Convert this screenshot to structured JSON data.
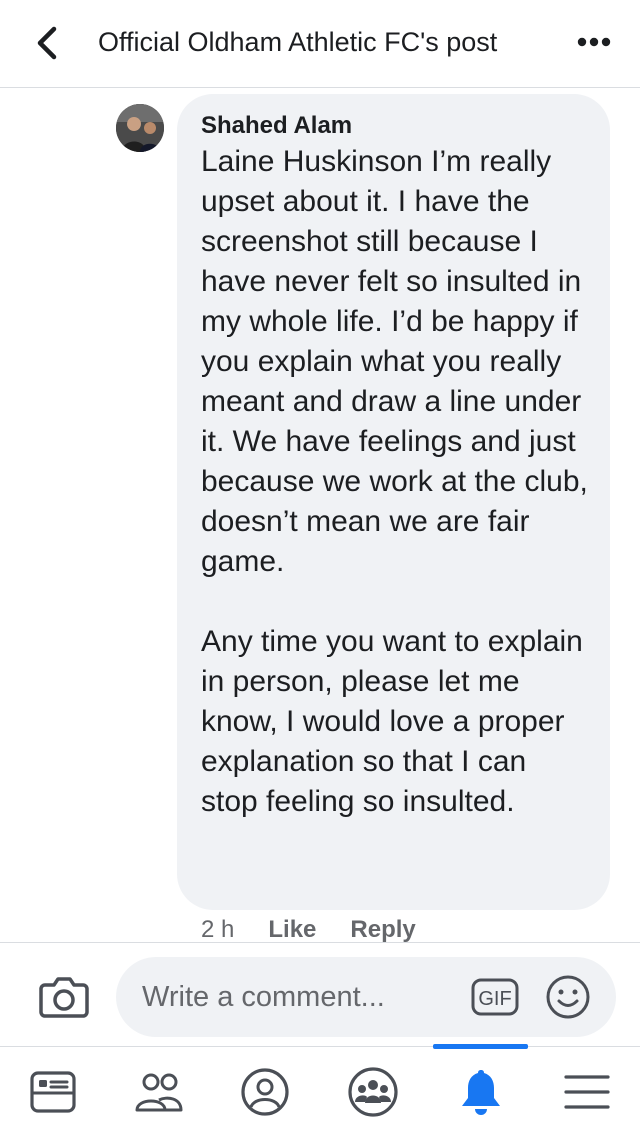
{
  "header": {
    "title": "Official Oldham Athletic FC's post",
    "back_icon": "chevron-left-icon",
    "more_icon": "more-dots-icon"
  },
  "comment": {
    "author": "Shahed Alam",
    "text": "Laine Huskinson I’m really upset about it. I have the screenshot still because I have never felt so insulted in my whole life. I’d be happy if you explain what you really meant and draw a line under it. We have feelings and just because we work at the club, doesn’t mean we are fair game.\n\nAny time you want to explain in person, please let me know, I would love a proper explanation so that I can stop feeling so insulted.",
    "time": "2 h",
    "like_label": "Like",
    "reply_label": "Reply"
  },
  "composer": {
    "placeholder": "Write a comment...",
    "gif_label": "GIF",
    "camera_icon": "camera-icon",
    "emoji_icon": "smiley-icon"
  },
  "tabs": [
    {
      "name": "news-feed",
      "icon": "news-feed-icon"
    },
    {
      "name": "friends",
      "icon": "friends-icon"
    },
    {
      "name": "profile",
      "icon": "profile-icon"
    },
    {
      "name": "groups",
      "icon": "groups-icon"
    },
    {
      "name": "notifications",
      "icon": "bell-icon",
      "active": true
    },
    {
      "name": "menu",
      "icon": "menu-icon"
    }
  ],
  "colors": {
    "accent": "#1877f2",
    "bubble": "#f0f2f5",
    "secondary_text": "#65676b",
    "icon": "#4b4f56"
  }
}
